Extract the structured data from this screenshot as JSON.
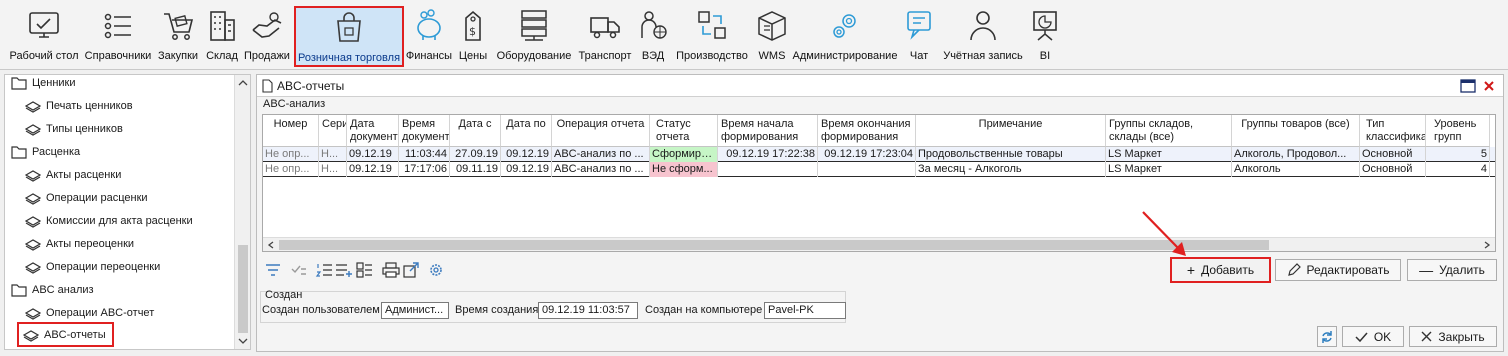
{
  "toolbar": {
    "items": [
      {
        "label": "Рабочий стол",
        "icon": "desktop-icon"
      },
      {
        "label": "Справочники",
        "icon": "list-icon"
      },
      {
        "label": "Закупки",
        "icon": "cart-icon"
      },
      {
        "label": "Склад",
        "icon": "building-icon"
      },
      {
        "label": "Продажи",
        "icon": "handshake-icon"
      },
      {
        "label": "Розничная торговля",
        "icon": "shopping-bag-icon",
        "selected": true
      },
      {
        "label": "Финансы",
        "icon": "piggy-bank-icon"
      },
      {
        "label": "Цены",
        "icon": "price-tag-icon"
      },
      {
        "label": "Оборудование",
        "icon": "server-icon"
      },
      {
        "label": "Транспорт",
        "icon": "truck-icon"
      },
      {
        "label": "ВЭД",
        "icon": "globe-person-icon"
      },
      {
        "label": "Производство",
        "icon": "cycle-icon"
      },
      {
        "label": "WMS",
        "icon": "box-icon"
      },
      {
        "label": "Администрирование",
        "icon": "gear-icon"
      },
      {
        "label": "Чат",
        "icon": "chat-icon"
      },
      {
        "label": "Учётная запись",
        "icon": "user-icon"
      },
      {
        "label": "BI",
        "icon": "presentation-chart-icon"
      }
    ]
  },
  "nav": {
    "items": [
      {
        "label": "Ценники",
        "type": "folder"
      },
      {
        "label": "Печать ценников",
        "type": "form"
      },
      {
        "label": "Типы ценников",
        "type": "form"
      },
      {
        "label": "Расценка",
        "type": "folder"
      },
      {
        "label": "Акты расценки",
        "type": "form"
      },
      {
        "label": "Операции расценки",
        "type": "form"
      },
      {
        "label": "Комиссии для акта расценки",
        "type": "form"
      },
      {
        "label": "Акты переоценки",
        "type": "form"
      },
      {
        "label": "Операции переоценки",
        "type": "form"
      },
      {
        "label": "ABC анализ",
        "type": "folder"
      },
      {
        "label": "Операции ABC-отчет",
        "type": "form"
      },
      {
        "label": "ABC-отчеты",
        "type": "form",
        "selected": true
      }
    ]
  },
  "panel": {
    "title": "ABC-отчеты",
    "subsection": "ABC-анализ",
    "columns": [
      "Номер",
      "Серия",
      "Дата документ",
      "Время документ",
      "Дата с",
      "Дата по",
      "Операция отчета",
      "Статус отчета",
      "Время начала формирования",
      "Время окончания формирования",
      "Примечание",
      "Группы складов, склады (все)",
      "Группы товаров (все)",
      "Тип классификат",
      "Уровень групп"
    ],
    "rows": [
      [
        "Не опр...",
        "Н...",
        "09.12.19",
        "11:03:44",
        "27.09.19",
        "09.12.19",
        "ABC-анализ по ...",
        "Сформиро...",
        "09.12.19 17:22:38",
        "09.12.19 17:23:04",
        "Продовольственные товары",
        "LS Маркет",
        "Алкоголь, Продовол...",
        "Основной",
        "5"
      ],
      [
        "Не опр...",
        "Н...",
        "09.12.19",
        "17:17:06",
        "09.11.19",
        "09.12.19",
        "ABC-анализ по ...",
        "Не сформ...",
        "",
        "",
        "За месяц - Алкоголь",
        "LS Маркет",
        "Алкоголь",
        "Основной",
        "4"
      ]
    ],
    "buttons": {
      "add": "Добавить",
      "edit": "Редактировать",
      "delete": "Удалить",
      "ok": "OK",
      "close": "Закрыть"
    },
    "created": {
      "group_title": "Создан",
      "user_label": "Создан пользователем",
      "user_value": "Админист...",
      "time_label": "Время создания",
      "time_value": "09.12.19 11:03:57",
      "computer_label": "Создан на компьютере",
      "computer_value": "Pavel-PK"
    }
  },
  "colors": {
    "selected_bg": "#cfe4f7",
    "highlight_border": "#e02020",
    "status_ok": "#c6f5c6",
    "status_err": "#f7c4cf"
  }
}
